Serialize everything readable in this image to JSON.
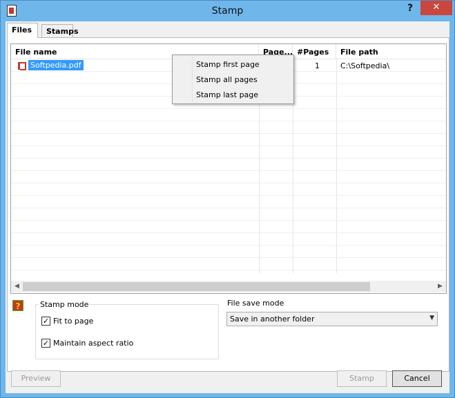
{
  "window": {
    "title": "Stamp",
    "help": "?",
    "close": "✕"
  },
  "tabs": [
    {
      "label": "Files",
      "active": true
    },
    {
      "label": "Stamps",
      "active": false
    }
  ],
  "grid": {
    "columns": [
      "File name",
      "Page...",
      "#Pages",
      "File path"
    ],
    "rows": [
      {
        "file_name": "Softpedia.pdf",
        "pages_range": "",
        "pages": "1",
        "file_path": "C:\\Softpedia\\"
      }
    ]
  },
  "context_menu": {
    "items": [
      "Stamp first page",
      "Stamp all pages",
      "Stamp last page"
    ]
  },
  "stamp_mode": {
    "title": "Stamp mode",
    "fit_to_page": {
      "label": "Fit to page",
      "checked": true
    },
    "maintain_aspect": {
      "label": "Maintain aspect ratio",
      "checked": true
    }
  },
  "file_save_mode": {
    "label": "File save mode",
    "selected": "Save in another folder"
  },
  "buttons": {
    "preview": "Preview",
    "stamp": "Stamp",
    "cancel": "Cancel"
  },
  "colors": {
    "titlebar": "#6fb6ea",
    "selection": "#3399ff",
    "close": "#c9473d"
  },
  "icons": {
    "app": "stamp-app-icon",
    "file": "pdf-file-icon",
    "help": "help-icon"
  }
}
